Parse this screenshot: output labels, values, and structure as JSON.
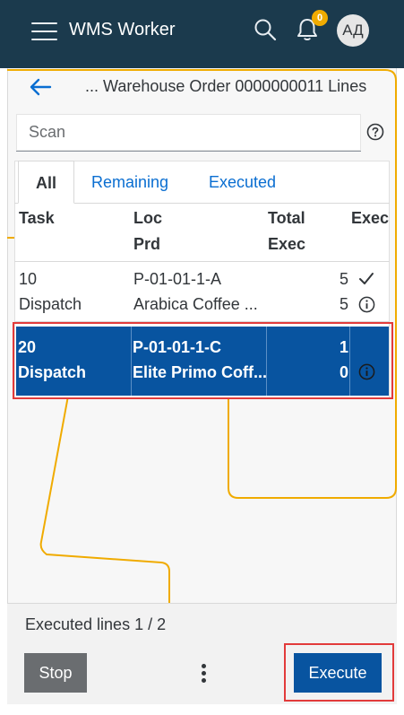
{
  "shell": {
    "app_title": "WMS Worker",
    "notification_count": "0",
    "avatar_initials": "АД",
    "icons": [
      "menu-icon",
      "search-icon",
      "bell-icon"
    ]
  },
  "header": {
    "title": "... Warehouse Order 0000000011 Lines"
  },
  "scan": {
    "placeholder": "Scan",
    "value": ""
  },
  "tabs": [
    {
      "label": "All",
      "selected": true
    },
    {
      "label": "Remaining",
      "selected": false
    },
    {
      "label": "Executed",
      "selected": false
    }
  ],
  "table": {
    "headers": {
      "task": "Task",
      "loc": "Loc",
      "prd": "Prd",
      "total": "Total",
      "exec_sub": "Exec",
      "exec": "Exec"
    },
    "rows": [
      {
        "task": "10",
        "type": "Dispatch",
        "loc": "P-01-01-1-A",
        "prd": "Arabica Coffee ...",
        "total": "5",
        "exec": "5",
        "status_icon": "checkmark-icon",
        "info_icon": "info-icon",
        "selected": false
      },
      {
        "task": "20",
        "type": "Dispatch",
        "loc": "P-01-01-1-C",
        "prd": "Elite Primo Coff...",
        "total": "1",
        "exec": "0",
        "info_icon": "info-icon",
        "selected": true
      }
    ]
  },
  "footer": {
    "executed_lines": "Executed lines 1 / 2",
    "stop_label": "Stop",
    "execute_label": "Execute"
  },
  "colors": {
    "shell_bg": "#1b3a4d",
    "accent": "#0854a0",
    "link": "#0a6ed1",
    "badge": "#f0ab00",
    "highlight_outline": "#e23b3b",
    "decoration_line": "#f0ab00"
  }
}
